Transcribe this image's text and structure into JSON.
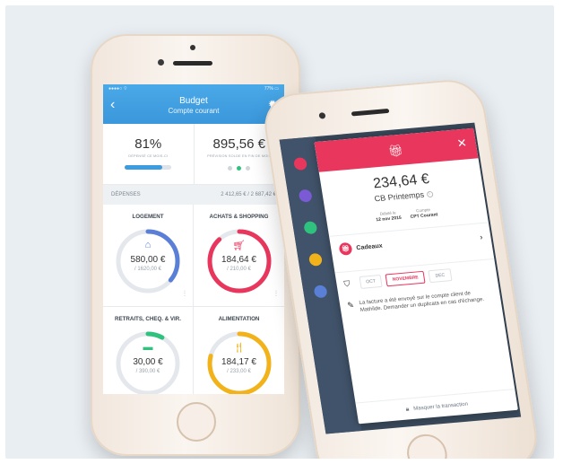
{
  "budget_phone": {
    "status": {
      "carrier": "●●●●○ ⌔",
      "battery": "77% ▭"
    },
    "nav": {
      "back": "‹",
      "title": "Budget",
      "subtitle": "Compte courant",
      "settings_icon": "gear-icon"
    },
    "stats": [
      {
        "value": "81%",
        "label": "DÉPENSÉ CE MOIS-CI",
        "progress": 0.81
      },
      {
        "value": "895,56 €",
        "label": "PRÉVISION SOLDE EN FIN DE MOIS"
      }
    ],
    "depenses": {
      "label": "DÉPENSES",
      "total": "2 412,65 € / 2 687,42 €"
    },
    "categories": [
      {
        "title": "LOGEMENT",
        "amount": "580,00 €",
        "total": "/ 1620,00 €",
        "icon": "home-icon",
        "color": "#5a7fd6",
        "progress": 0.36
      },
      {
        "title": "ACHATS & SHOPPING",
        "amount": "184,64 €",
        "total": "/ 210,00 €",
        "icon": "cart-icon",
        "color": "#e8365d",
        "progress": 0.88
      },
      {
        "title": "RETRAITS, CHEQ. & VIR.",
        "amount": "30,00 €",
        "total": "/ 390,00 €",
        "icon": "card-icon",
        "color": "#2ec27e",
        "progress": 0.08
      },
      {
        "title": "ALIMENTATION",
        "amount": "184,17 €",
        "total": "/ 233,00 €",
        "icon": "food-icon",
        "color": "#f2b21a",
        "progress": 0.79
      }
    ]
  },
  "transaction_phone": {
    "amount": "234,64 €",
    "merchant": "CB Printemps",
    "debit_label": "Débité le",
    "debit_date": "12 nov 2015",
    "account_label": "Compte",
    "account_value": "CPT Courant",
    "category": "Cadeaux",
    "months": [
      "OCT",
      "NOVEMBRE",
      "DEC"
    ],
    "selected_month": "NOVEMBRE",
    "note": "La facture a été envoyé sur le compte client de Mathilde. Demander un duplicata en cas d'échange.",
    "hide_button": "Masquer la transaction",
    "accent": "#e8365d"
  }
}
